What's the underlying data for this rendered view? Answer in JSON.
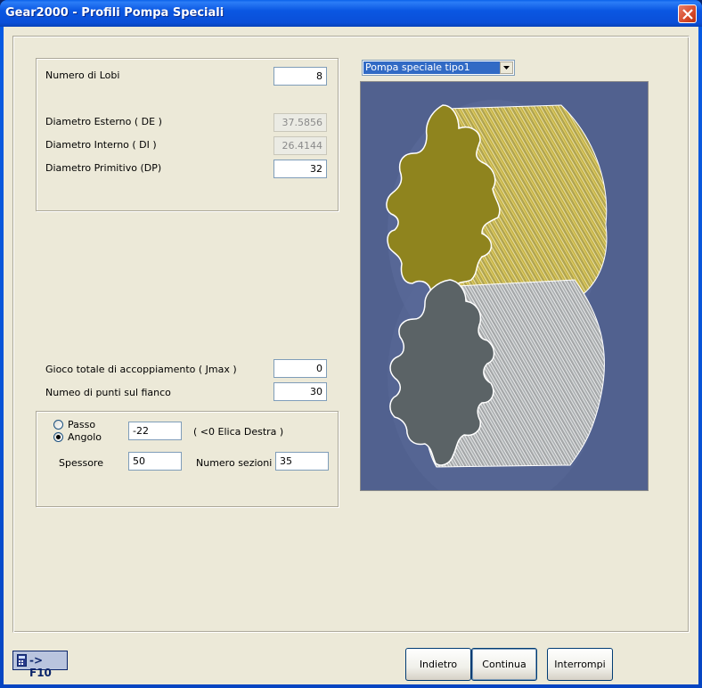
{
  "window": {
    "title": "Gear2000 - Profili Pompa Speciali"
  },
  "params": {
    "lobes_label": "Numero di Lobi",
    "lobes_value": "8",
    "de_label": "Diametro Esterno ( DE )",
    "de_value": "37.5856",
    "di_label": "Diametro Interno ( DI )",
    "di_value": "26.4144",
    "dp_label": "Diametro Primitivo (DP)",
    "dp_value": "32",
    "jmax_label": "Gioco totale di accoppiamento ( Jmax )",
    "jmax_value": "0",
    "points_label": "Numeo di punti sul fianco",
    "points_value": "30"
  },
  "helix": {
    "passo_label": "Passo",
    "angolo_label": "Angolo",
    "selected": "Angolo",
    "angle_value": "-22",
    "angle_hint": "( <0 Elica Destra )",
    "spessore_label": "Spessore",
    "spessore_value": "50",
    "sections_label": "Numero sezioni",
    "sections_value": "35"
  },
  "preview": {
    "selected_type": "Pompa speciale tipo1"
  },
  "buttons": {
    "back": "Indietro",
    "continue": "Continua",
    "cancel": "Interrompi"
  },
  "shortcut": {
    "label": "-> F10",
    "icon": "calculator-icon"
  },
  "colors": {
    "gear_gold": "#8f841e",
    "gear_gray": "#5b6366",
    "viewer_bg": "#51618f"
  }
}
